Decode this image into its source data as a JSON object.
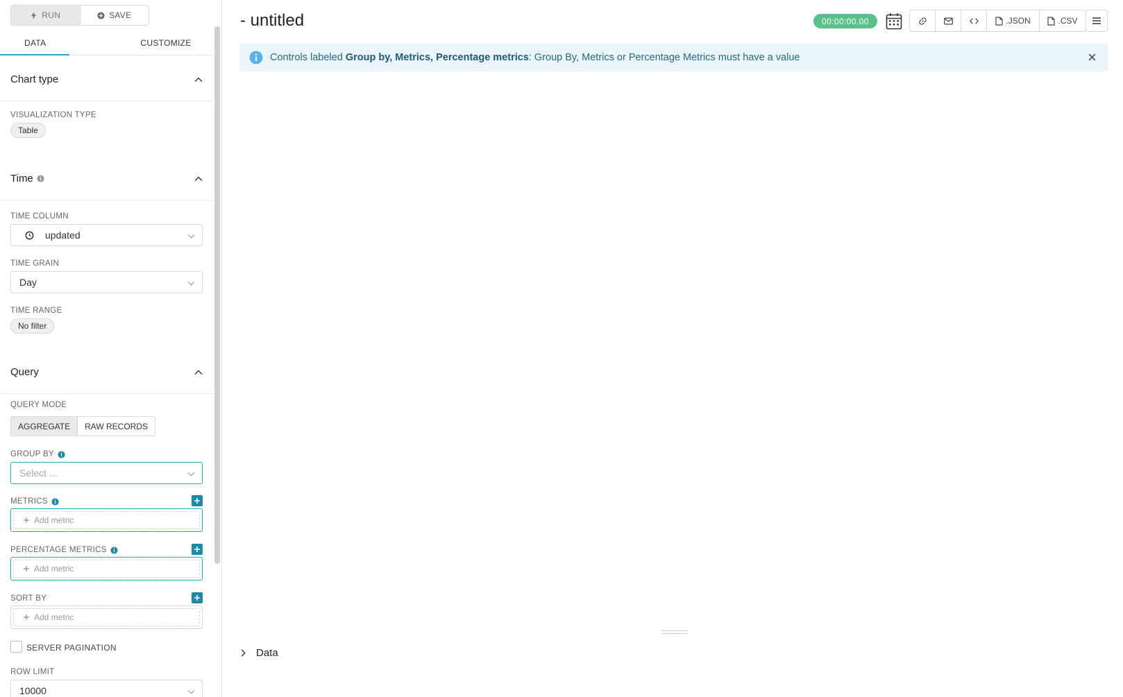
{
  "toolbar": {
    "run_label": "RUN",
    "save_label": "SAVE"
  },
  "tabs": [
    {
      "label": "DATA",
      "active": true
    },
    {
      "label": "CUSTOMIZE",
      "active": false
    }
  ],
  "sections": {
    "chart_type": {
      "title": "Chart type",
      "viz_label": "VISUALIZATION TYPE",
      "viz_value": "Table"
    },
    "time": {
      "title": "Time",
      "time_column_label": "TIME COLUMN",
      "time_column_value": "updated",
      "time_grain_label": "TIME GRAIN",
      "time_grain_value": "Day",
      "time_range_label": "TIME RANGE",
      "time_range_value": "No filter"
    },
    "query": {
      "title": "Query",
      "query_mode_label": "QUERY MODE",
      "mode_aggregate": "AGGREGATE",
      "mode_raw": "RAW RECORDS",
      "group_by_label": "GROUP BY",
      "group_by_placeholder": "Select ...",
      "metrics_label": "METRICS",
      "metrics_add": "Add metric",
      "pct_metrics_label": "PERCENTAGE METRICS",
      "pct_metrics_add": "Add metric",
      "sort_by_label": "SORT BY",
      "sort_by_add": "Add metric",
      "server_pagination_label": "SERVER PAGINATION",
      "row_limit_label": "ROW LIMIT",
      "row_limit_value": "10000"
    }
  },
  "header": {
    "title": "- untitled",
    "timer": "00:00:00.00",
    "json_label": ".JSON",
    "csv_label": ".CSV"
  },
  "alert": {
    "prefix": "Controls labeled ",
    "bold": "Group by, Metrics, Percentage metrics",
    "suffix": ": Group By, Metrics or Percentage Metrics must have a value"
  },
  "data_pane": {
    "label": "Data"
  },
  "colors": {
    "accent": "#20a7c9",
    "timer_green": "#5ac189",
    "alert_bg": "#eaf6fb",
    "plus_btn": "#1d8aa5"
  }
}
